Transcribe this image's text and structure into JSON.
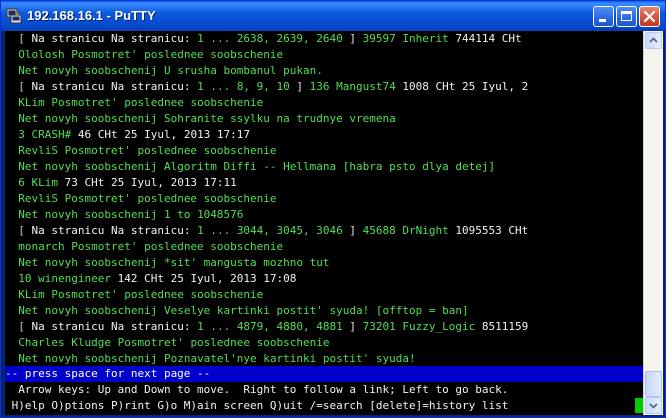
{
  "window": {
    "title": "192.168.16.1 - PuTTY"
  },
  "colors": {
    "green": "#55DD55",
    "white": "#F2F2F2",
    "gray": "#C0C0C0",
    "status_bg": "#0000CC",
    "cursor": "#00CC00"
  },
  "icons": {
    "app": "putty-icon",
    "minimize": "minimize-icon",
    "maximize": "maximize-icon",
    "close": "close-icon"
  },
  "lines": [
    [
      {
        "t": "  [ ",
        "c": "gray"
      },
      {
        "t": "Na stranicu",
        "c": "white"
      },
      {
        "t": " Na stranicu: ",
        "c": "white"
      },
      {
        "t": "1 ... 2638, 2639, 2640",
        "c": "green"
      },
      {
        "t": " ] ",
        "c": "white"
      },
      {
        "t": "39597 Inherit",
        "c": "green"
      },
      {
        "t": " 744114 CHt",
        "c": "white"
      }
    ],
    [
      {
        "t": "  Ololosh",
        "c": "green"
      },
      {
        "t": " Posmotret' poslednee soobschenie",
        "c": "green"
      }
    ],
    [
      {
        "t": "  Net novyh soobschenij",
        "c": "green"
      },
      {
        "t": " U srusha bombanul pukan.",
        "c": "green"
      }
    ],
    [
      {
        "t": "  [ ",
        "c": "gray"
      },
      {
        "t": "Na stranicu Na stranicu: ",
        "c": "white"
      },
      {
        "t": "1 ... 8, 9, 10",
        "c": "green"
      },
      {
        "t": " ] ",
        "c": "white"
      },
      {
        "t": "136 Mangust74",
        "c": "green"
      },
      {
        "t": " 1008 CHt 25 Iyul, 2",
        "c": "white"
      }
    ],
    [
      {
        "t": "  KLim",
        "c": "green"
      },
      {
        "t": " Posmotret' poslednee soobschenie",
        "c": "green"
      }
    ],
    [
      {
        "t": "  Net novyh soobschenij",
        "c": "green"
      },
      {
        "t": " Sohranite ssylku na trudnye vremena",
        "c": "green"
      }
    ],
    [
      {
        "t": "  3 CRASH#",
        "c": "green"
      },
      {
        "t": " 46 CHt 25 Iyul, 2013 17:17",
        "c": "white"
      }
    ],
    [
      {
        "t": "  RevliS",
        "c": "green"
      },
      {
        "t": " Posmotret' poslednee soobschenie",
        "c": "green"
      }
    ],
    [
      {
        "t": "  Net novyh soobschenij",
        "c": "green"
      },
      {
        "t": " Algoritm Diffi -- Hellmana [habra psto dlya detej]",
        "c": "green"
      }
    ],
    [
      {
        "t": "  6 KLim",
        "c": "green"
      },
      {
        "t": " 73 CHt 25 Iyul, 2013 17:11",
        "c": "white"
      }
    ],
    [
      {
        "t": "  RevliS",
        "c": "green"
      },
      {
        "t": " Posmotret' poslednee soobschenie",
        "c": "green"
      }
    ],
    [
      {
        "t": "  Net novyh soobschenij",
        "c": "green"
      },
      {
        "t": " 1 to 1048576",
        "c": "green"
      }
    ],
    [
      {
        "t": "  [ ",
        "c": "gray"
      },
      {
        "t": "Na stranicu Na stranicu: ",
        "c": "white"
      },
      {
        "t": "1 ... 3044, 3045, 3046",
        "c": "green"
      },
      {
        "t": " ] ",
        "c": "white"
      },
      {
        "t": "45688 DrNight",
        "c": "green"
      },
      {
        "t": " 1095553 CHt",
        "c": "white"
      }
    ],
    [
      {
        "t": "  monarch",
        "c": "green"
      },
      {
        "t": " Posmotret' poslednee soobschenie",
        "c": "green"
      }
    ],
    [
      {
        "t": "  Net novyh soobschenij",
        "c": "green"
      },
      {
        "t": " *sit' mangusta mozhno tut",
        "c": "green"
      }
    ],
    [
      {
        "t": "  10 winengineer",
        "c": "green"
      },
      {
        "t": " 142 CHt 25 Iyul, 2013 17:08",
        "c": "white"
      }
    ],
    [
      {
        "t": "  KLim",
        "c": "green"
      },
      {
        "t": " Posmotret' poslednee soobschenie",
        "c": "green"
      }
    ],
    [
      {
        "t": "  Net novyh soobschenij",
        "c": "green"
      },
      {
        "t": " Veselye kartinki postit' syuda! [offtop = ban]",
        "c": "green"
      }
    ],
    [
      {
        "t": "  [ ",
        "c": "gray"
      },
      {
        "t": "Na stranicu Na stranicu: ",
        "c": "white"
      },
      {
        "t": "1 ... 4879, 4880, 4881",
        "c": "green"
      },
      {
        "t": " ] ",
        "c": "white"
      },
      {
        "t": "73201 Fuzzy_Logic",
        "c": "green"
      },
      {
        "t": " 8511159",
        "c": "white"
      }
    ],
    [
      {
        "t": "  Charles Kludge",
        "c": "green"
      },
      {
        "t": " Posmotret' poslednee soobschenie",
        "c": "green"
      }
    ],
    [
      {
        "t": "  Net novyh soobschenij",
        "c": "green"
      },
      {
        "t": " Poznavatel'nye kartinki postit' syuda!",
        "c": "green"
      }
    ]
  ],
  "status_line": "-- press space for next page --",
  "help_lines": [
    "  Arrow keys: Up and Down to move.  Right to follow a link; Left to go back.",
    " H)elp O)ptions P)rint G)o M)ain screen Q)uit /=search [delete]=history list"
  ]
}
